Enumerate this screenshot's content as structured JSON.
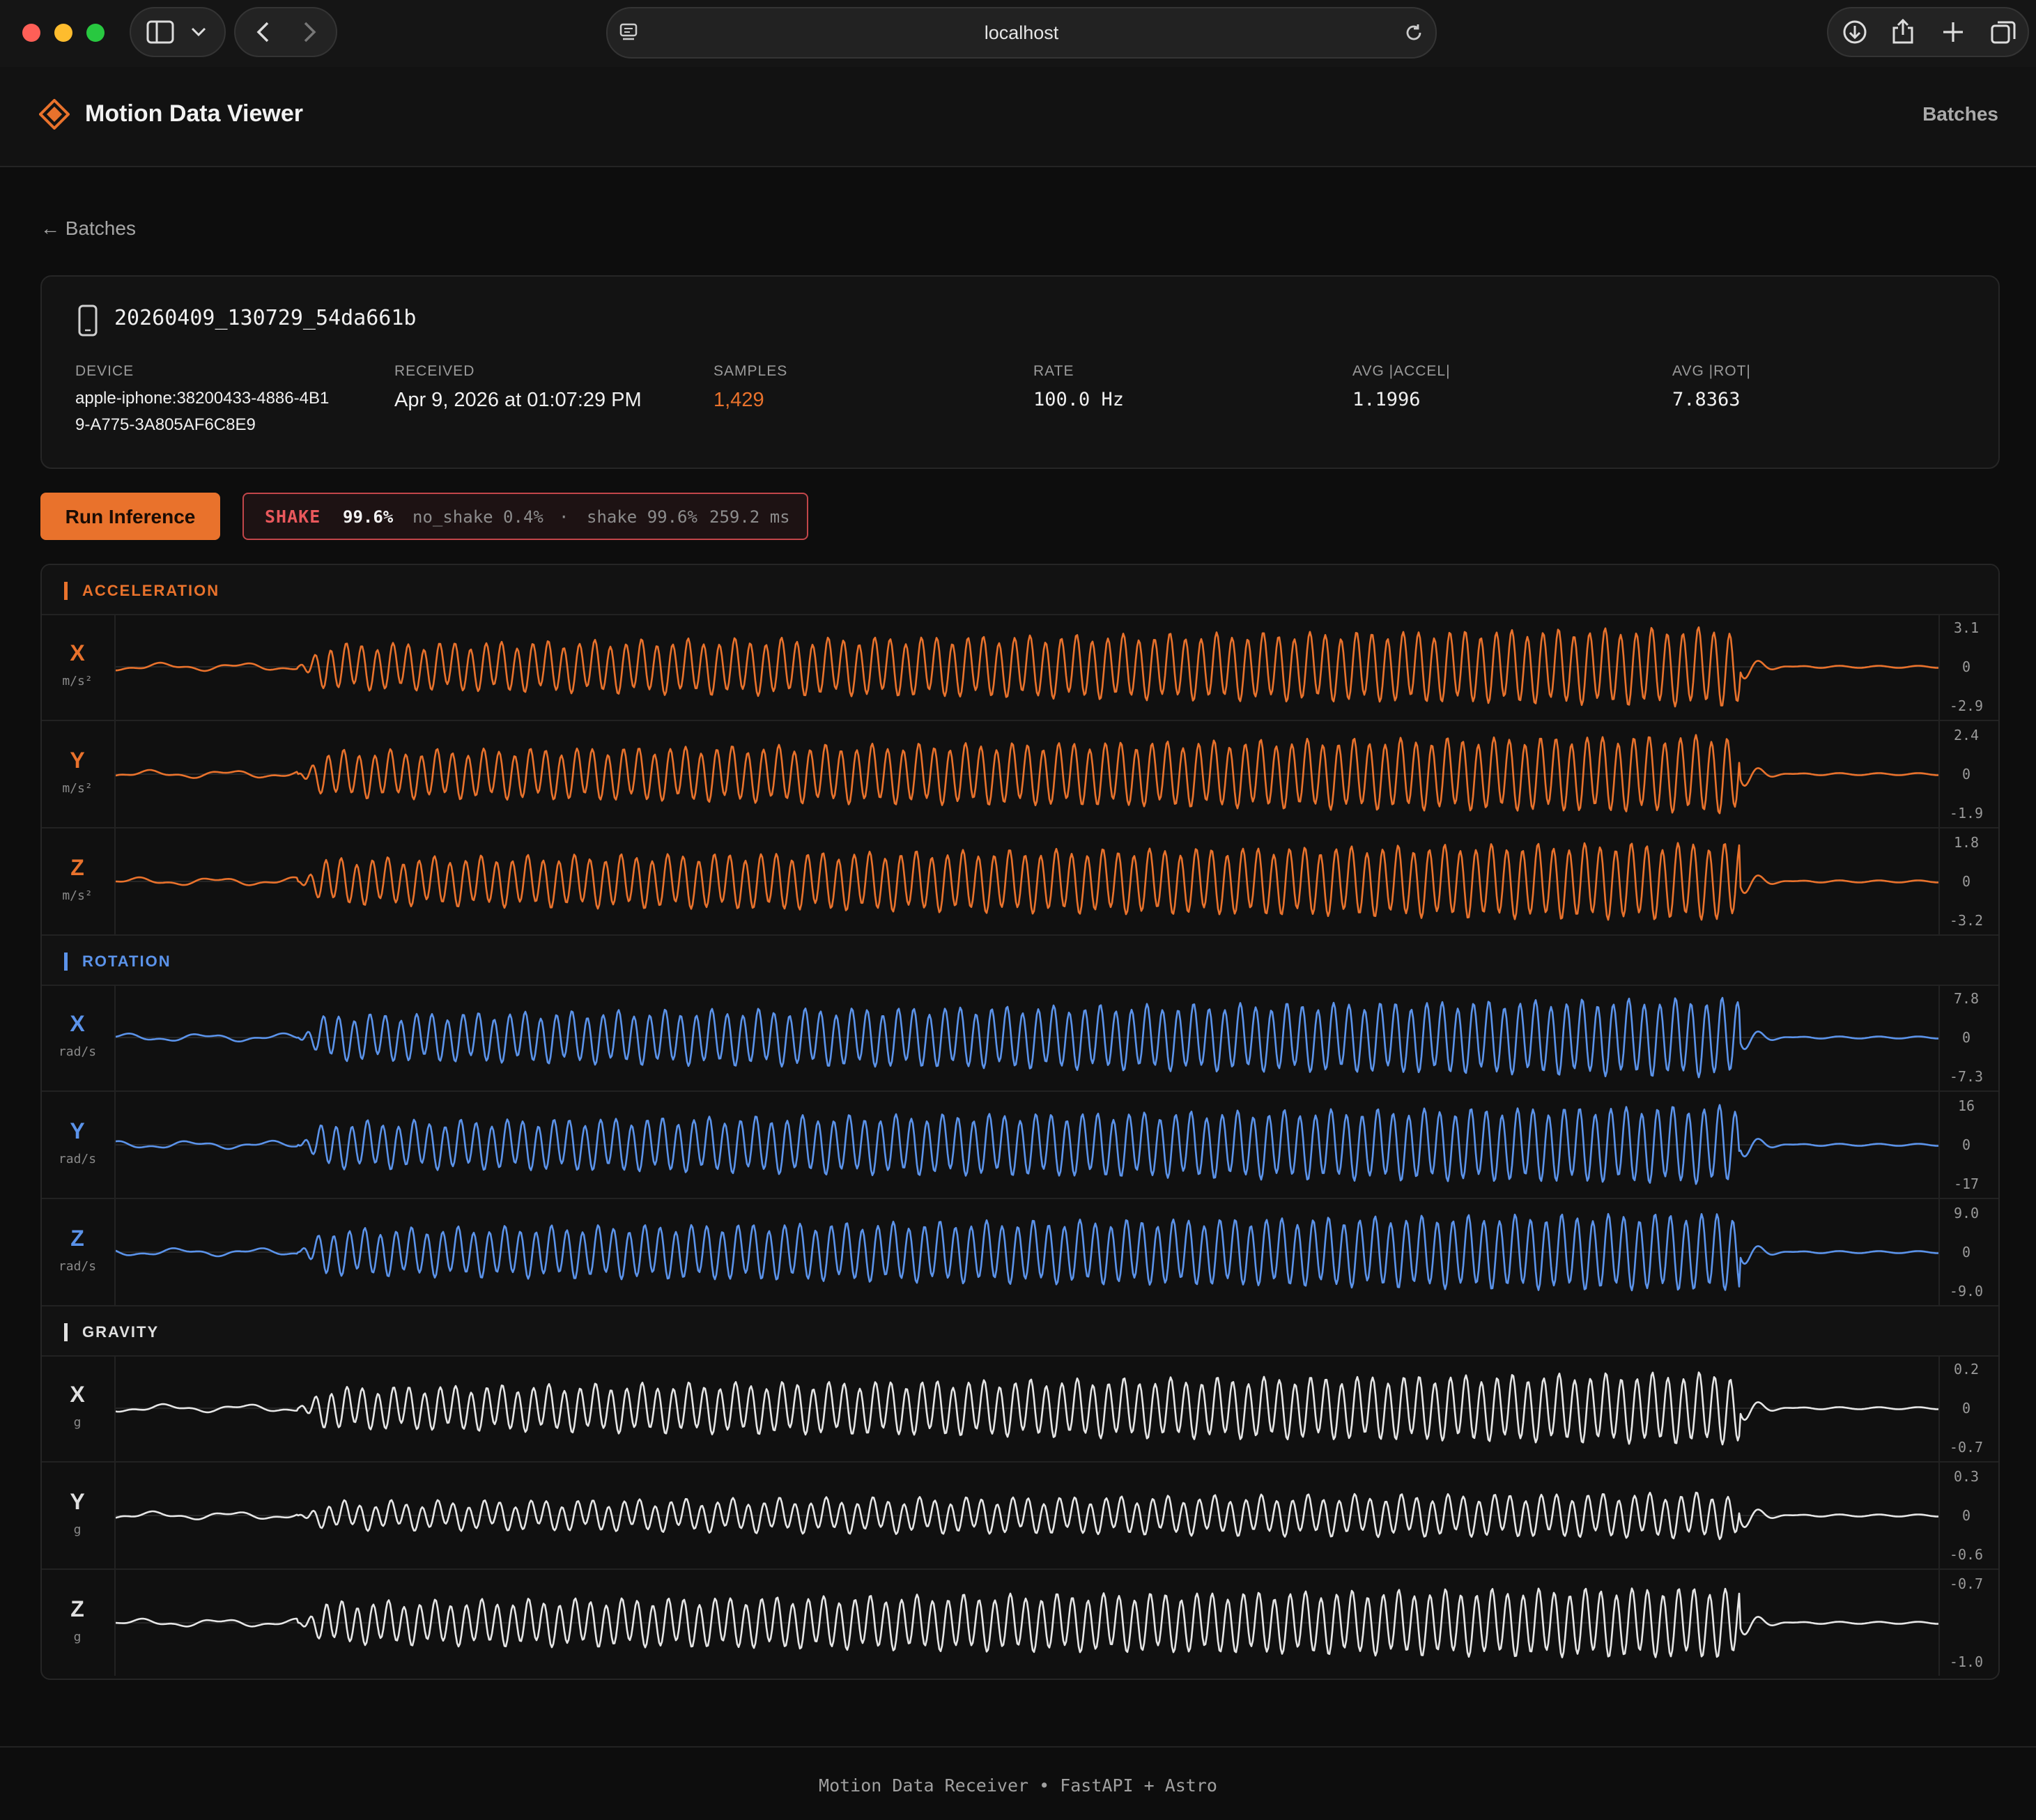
{
  "browser": {
    "url": "localhost"
  },
  "app": {
    "title": "Motion Data Viewer",
    "nav_batches": "Batches",
    "back_link": "← Batches",
    "accent": "#e9722c"
  },
  "batch": {
    "id": "20260409_130729_54da661b",
    "meta": [
      {
        "label": "DEVICE",
        "value_lines": [
          "apple-iphone:38200433-4886-4B1",
          "9-A775-3A805AF6C8E9"
        ]
      },
      {
        "label": "RECEIVED",
        "value_lines": [
          "Apr 9, 2026 at 01:07:29 PM"
        ]
      },
      {
        "label": "SAMPLES",
        "value_lines": [
          "1,429"
        ]
      },
      {
        "label": "RATE",
        "value_lines": [
          "100.0 Hz"
        ]
      },
      {
        "label": "AVG |ACCEL|",
        "value_lines": [
          "1.1996"
        ]
      },
      {
        "label": "AVG |ROT|",
        "value_lines": [
          "7.8363"
        ]
      }
    ]
  },
  "inference": {
    "button": "Run Inference",
    "label": "SHAKE",
    "confidence": "99.6%",
    "no_shake": "no_shake 0.4%",
    "separator": "·",
    "shake": "shake 99.6%",
    "latency": "259.2 ms"
  },
  "sections": [
    {
      "title": "ACCELERATION",
      "color": "#e9722c",
      "axes": [
        {
          "axis": "X",
          "unit": "m/s²",
          "ticks": [
            "3.1",
            "0",
            "-2.9"
          ]
        },
        {
          "axis": "Y",
          "unit": "m/s²",
          "ticks": [
            "2.4",
            "0",
            "-1.9"
          ]
        },
        {
          "axis": "Z",
          "unit": "m/s²",
          "ticks": [
            "1.8",
            "0",
            "-3.2"
          ]
        }
      ]
    },
    {
      "title": "ROTATION",
      "color": "#5b93ea",
      "axes": [
        {
          "axis": "X",
          "unit": "rad/s",
          "ticks": [
            "7.8",
            "0",
            "-7.3"
          ]
        },
        {
          "axis": "Y",
          "unit": "rad/s",
          "ticks": [
            "16",
            "0",
            "-17"
          ]
        },
        {
          "axis": "Z",
          "unit": "rad/s",
          "ticks": [
            "9.0",
            "0",
            "-9.0"
          ]
        }
      ]
    },
    {
      "title": "GRAVITY",
      "color": "#e0e0e0",
      "axes": [
        {
          "axis": "X",
          "unit": "g",
          "ticks": [
            "0.2",
            "0",
            "-0.7"
          ]
        },
        {
          "axis": "Y",
          "unit": "g",
          "ticks": [
            "0.3",
            "0",
            "-0.6"
          ]
        },
        {
          "axis": "Z",
          "unit": "g",
          "ticks": [
            "-0.7",
            "",
            "-1.0"
          ]
        }
      ]
    }
  ],
  "footer": "Motion Data Receiver • FastAPI + Astro"
}
